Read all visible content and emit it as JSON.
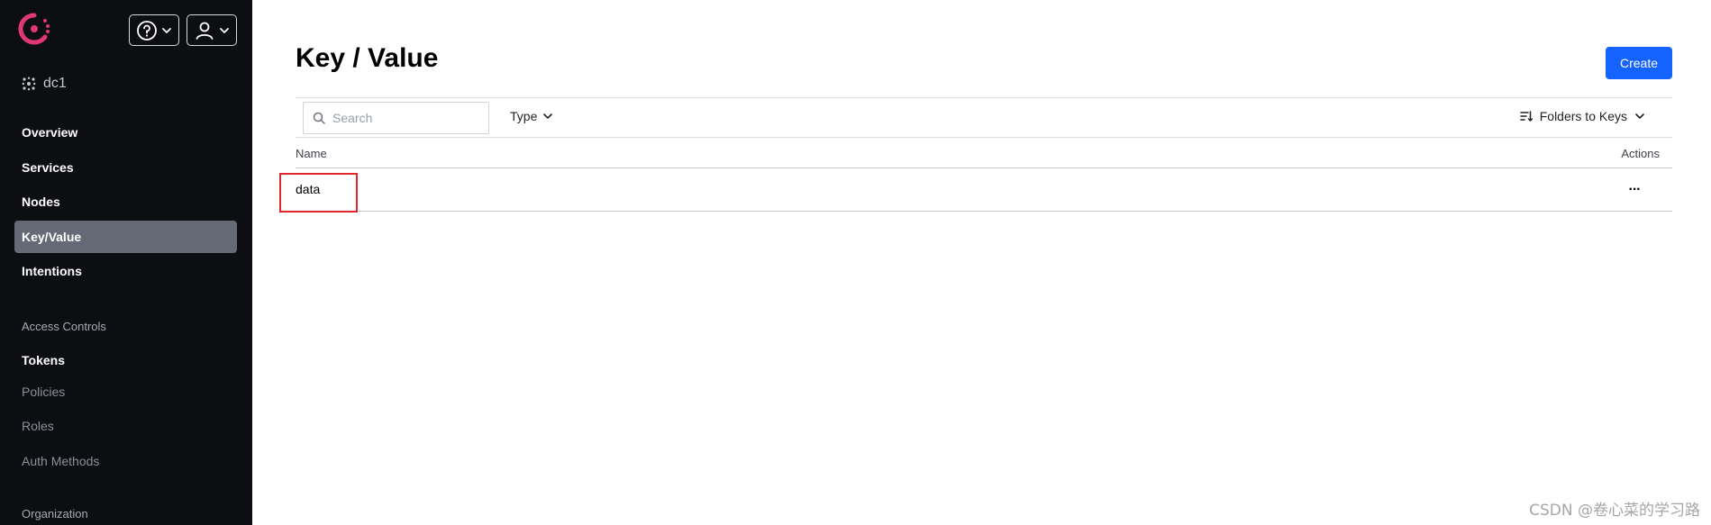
{
  "sidebar": {
    "datacenter": "dc1",
    "nav": [
      {
        "label": "Overview"
      },
      {
        "label": "Services"
      },
      {
        "label": "Nodes"
      },
      {
        "label": "Key/Value"
      },
      {
        "label": "Intentions"
      }
    ],
    "access_section": "Access Controls",
    "access_items": [
      {
        "label": "Tokens"
      },
      {
        "label": "Policies"
      },
      {
        "label": "Roles"
      },
      {
        "label": "Auth Methods"
      }
    ],
    "org_section": "Organization"
  },
  "header": {
    "help_icon": "help-circle-icon",
    "user_icon": "user-icon"
  },
  "main": {
    "title": "Key / Value",
    "create_label": "Create",
    "search_placeholder": "Search",
    "type_filter": "Type",
    "sort_filter": "Folders to Keys",
    "columns": {
      "name": "Name",
      "actions": "Actions"
    },
    "rows": [
      {
        "name": "data",
        "actions": "···"
      }
    ]
  },
  "watermark": "CSDN @卷心菜的学习路",
  "colors": {
    "sidebar_bg": "#0d0e12",
    "active_nav": "#656a76",
    "primary": "#1563ff",
    "brand": "#e03875",
    "highlight": "#e0262b"
  }
}
